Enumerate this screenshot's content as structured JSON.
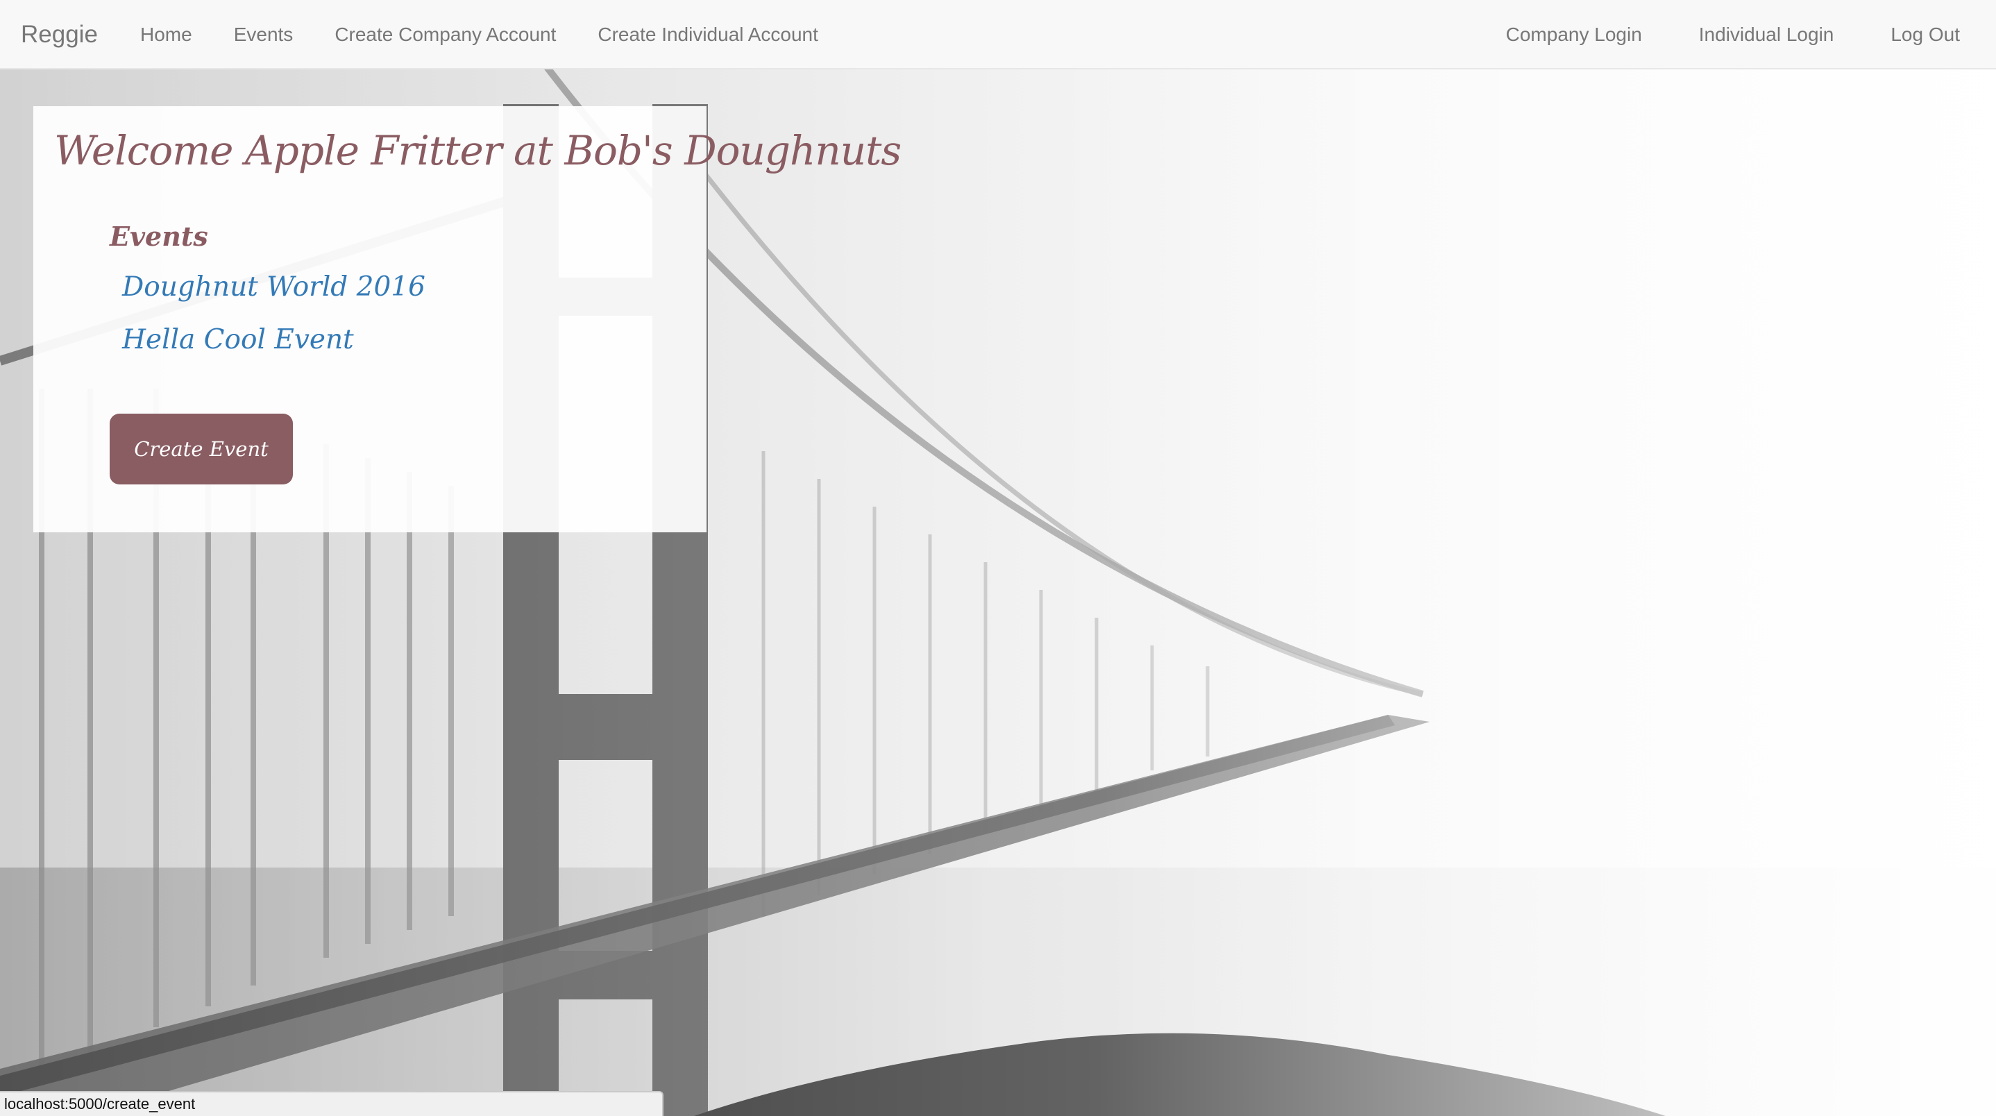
{
  "navbar": {
    "brand": "Reggie",
    "left_links": [
      "Home",
      "Events",
      "Create Company Account",
      "Create Individual Account"
    ],
    "right_links": [
      "Company Login",
      "Individual Login",
      "Log Out"
    ]
  },
  "main": {
    "welcome_title": "Welcome Apple Fritter at Bob's Doughnuts",
    "events_heading": "Events",
    "events": [
      "Doughnut World 2016",
      "Hella Cool Event"
    ],
    "create_event_label": "Create Event"
  },
  "status_bar": {
    "url": "localhost:5000/create_event"
  },
  "colors": {
    "accent": "#895d62",
    "link": "#337ab7",
    "navbar_bg": "#f8f8f8",
    "nav_text": "#777777"
  },
  "background_image": "foggy-suspension-bridge-photo"
}
